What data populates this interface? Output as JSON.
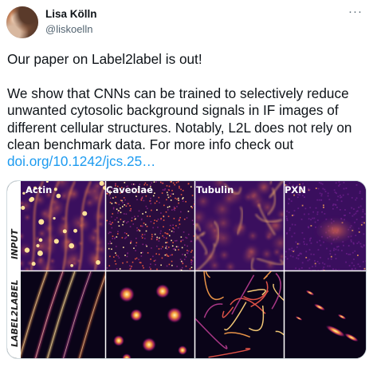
{
  "author": {
    "name": "Lisa Kölln",
    "handle": "@liskoelln",
    "avatar_icon": "profile-photo",
    "more_icon": "more-options-icon"
  },
  "tweet": {
    "line1": "Our paper on Label2label is out!",
    "line2_pre": "We show that CNNs can be trained to selectively reduce unwanted cytosolic background signals in IF images of different cellular structures. Notably, L2L does not rely on clean benchmark data. For more info check out ",
    "link_text": "doi.org/10.1242/jcs.25…",
    "link_color": "#1d9bf0"
  },
  "figure": {
    "columns": [
      "Actin",
      "Caveolae",
      "Tubulin",
      "PXN"
    ],
    "rows": [
      "INPUT",
      "LABEL2LABEL"
    ]
  }
}
